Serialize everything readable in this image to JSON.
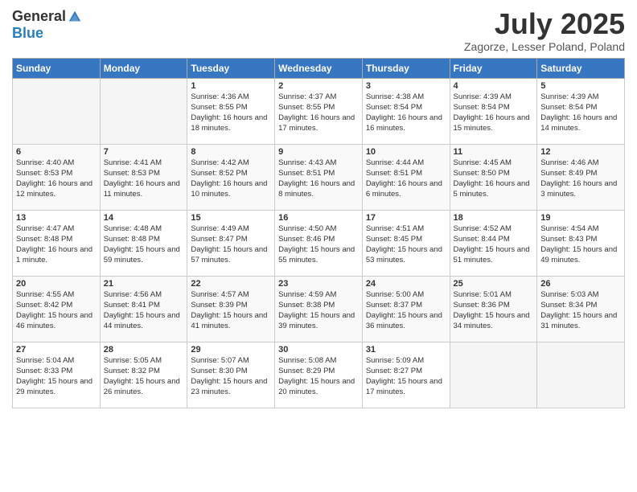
{
  "logo": {
    "general": "General",
    "blue": "Blue"
  },
  "title": "July 2025",
  "subtitle": "Zagorze, Lesser Poland, Poland",
  "days_of_week": [
    "Sunday",
    "Monday",
    "Tuesday",
    "Wednesday",
    "Thursday",
    "Friday",
    "Saturday"
  ],
  "weeks": [
    [
      {
        "day": "",
        "info": ""
      },
      {
        "day": "",
        "info": ""
      },
      {
        "day": "1",
        "sunrise": "Sunrise: 4:36 AM",
        "sunset": "Sunset: 8:55 PM",
        "daylight": "Daylight: 16 hours and 18 minutes."
      },
      {
        "day": "2",
        "sunrise": "Sunrise: 4:37 AM",
        "sunset": "Sunset: 8:55 PM",
        "daylight": "Daylight: 16 hours and 17 minutes."
      },
      {
        "day": "3",
        "sunrise": "Sunrise: 4:38 AM",
        "sunset": "Sunset: 8:54 PM",
        "daylight": "Daylight: 16 hours and 16 minutes."
      },
      {
        "day": "4",
        "sunrise": "Sunrise: 4:39 AM",
        "sunset": "Sunset: 8:54 PM",
        "daylight": "Daylight: 16 hours and 15 minutes."
      },
      {
        "day": "5",
        "sunrise": "Sunrise: 4:39 AM",
        "sunset": "Sunset: 8:54 PM",
        "daylight": "Daylight: 16 hours and 14 minutes."
      }
    ],
    [
      {
        "day": "6",
        "sunrise": "Sunrise: 4:40 AM",
        "sunset": "Sunset: 8:53 PM",
        "daylight": "Daylight: 16 hours and 12 minutes."
      },
      {
        "day": "7",
        "sunrise": "Sunrise: 4:41 AM",
        "sunset": "Sunset: 8:53 PM",
        "daylight": "Daylight: 16 hours and 11 minutes."
      },
      {
        "day": "8",
        "sunrise": "Sunrise: 4:42 AM",
        "sunset": "Sunset: 8:52 PM",
        "daylight": "Daylight: 16 hours and 10 minutes."
      },
      {
        "day": "9",
        "sunrise": "Sunrise: 4:43 AM",
        "sunset": "Sunset: 8:51 PM",
        "daylight": "Daylight: 16 hours and 8 minutes."
      },
      {
        "day": "10",
        "sunrise": "Sunrise: 4:44 AM",
        "sunset": "Sunset: 8:51 PM",
        "daylight": "Daylight: 16 hours and 6 minutes."
      },
      {
        "day": "11",
        "sunrise": "Sunrise: 4:45 AM",
        "sunset": "Sunset: 8:50 PM",
        "daylight": "Daylight: 16 hours and 5 minutes."
      },
      {
        "day": "12",
        "sunrise": "Sunrise: 4:46 AM",
        "sunset": "Sunset: 8:49 PM",
        "daylight": "Daylight: 16 hours and 3 minutes."
      }
    ],
    [
      {
        "day": "13",
        "sunrise": "Sunrise: 4:47 AM",
        "sunset": "Sunset: 8:48 PM",
        "daylight": "Daylight: 16 hours and 1 minute."
      },
      {
        "day": "14",
        "sunrise": "Sunrise: 4:48 AM",
        "sunset": "Sunset: 8:48 PM",
        "daylight": "Daylight: 15 hours and 59 minutes."
      },
      {
        "day": "15",
        "sunrise": "Sunrise: 4:49 AM",
        "sunset": "Sunset: 8:47 PM",
        "daylight": "Daylight: 15 hours and 57 minutes."
      },
      {
        "day": "16",
        "sunrise": "Sunrise: 4:50 AM",
        "sunset": "Sunset: 8:46 PM",
        "daylight": "Daylight: 15 hours and 55 minutes."
      },
      {
        "day": "17",
        "sunrise": "Sunrise: 4:51 AM",
        "sunset": "Sunset: 8:45 PM",
        "daylight": "Daylight: 15 hours and 53 minutes."
      },
      {
        "day": "18",
        "sunrise": "Sunrise: 4:52 AM",
        "sunset": "Sunset: 8:44 PM",
        "daylight": "Daylight: 15 hours and 51 minutes."
      },
      {
        "day": "19",
        "sunrise": "Sunrise: 4:54 AM",
        "sunset": "Sunset: 8:43 PM",
        "daylight": "Daylight: 15 hours and 49 minutes."
      }
    ],
    [
      {
        "day": "20",
        "sunrise": "Sunrise: 4:55 AM",
        "sunset": "Sunset: 8:42 PM",
        "daylight": "Daylight: 15 hours and 46 minutes."
      },
      {
        "day": "21",
        "sunrise": "Sunrise: 4:56 AM",
        "sunset": "Sunset: 8:41 PM",
        "daylight": "Daylight: 15 hours and 44 minutes."
      },
      {
        "day": "22",
        "sunrise": "Sunrise: 4:57 AM",
        "sunset": "Sunset: 8:39 PM",
        "daylight": "Daylight: 15 hours and 41 minutes."
      },
      {
        "day": "23",
        "sunrise": "Sunrise: 4:59 AM",
        "sunset": "Sunset: 8:38 PM",
        "daylight": "Daylight: 15 hours and 39 minutes."
      },
      {
        "day": "24",
        "sunrise": "Sunrise: 5:00 AM",
        "sunset": "Sunset: 8:37 PM",
        "daylight": "Daylight: 15 hours and 36 minutes."
      },
      {
        "day": "25",
        "sunrise": "Sunrise: 5:01 AM",
        "sunset": "Sunset: 8:36 PM",
        "daylight": "Daylight: 15 hours and 34 minutes."
      },
      {
        "day": "26",
        "sunrise": "Sunrise: 5:03 AM",
        "sunset": "Sunset: 8:34 PM",
        "daylight": "Daylight: 15 hours and 31 minutes."
      }
    ],
    [
      {
        "day": "27",
        "sunrise": "Sunrise: 5:04 AM",
        "sunset": "Sunset: 8:33 PM",
        "daylight": "Daylight: 15 hours and 29 minutes."
      },
      {
        "day": "28",
        "sunrise": "Sunrise: 5:05 AM",
        "sunset": "Sunset: 8:32 PM",
        "daylight": "Daylight: 15 hours and 26 minutes."
      },
      {
        "day": "29",
        "sunrise": "Sunrise: 5:07 AM",
        "sunset": "Sunset: 8:30 PM",
        "daylight": "Daylight: 15 hours and 23 minutes."
      },
      {
        "day": "30",
        "sunrise": "Sunrise: 5:08 AM",
        "sunset": "Sunset: 8:29 PM",
        "daylight": "Daylight: 15 hours and 20 minutes."
      },
      {
        "day": "31",
        "sunrise": "Sunrise: 5:09 AM",
        "sunset": "Sunset: 8:27 PM",
        "daylight": "Daylight: 15 hours and 17 minutes."
      },
      {
        "day": "",
        "info": ""
      },
      {
        "day": "",
        "info": ""
      }
    ]
  ]
}
